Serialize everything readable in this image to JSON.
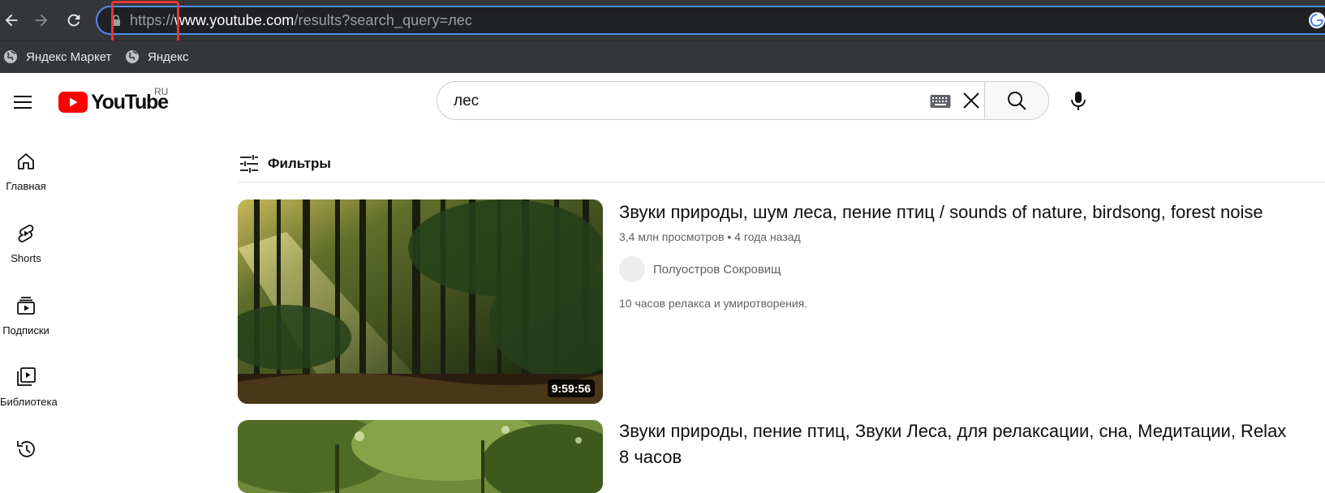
{
  "browser": {
    "url_scheme": "https://",
    "url_host": "www.youtube.com",
    "url_path": "/results?search_query=лес",
    "bookmarks": [
      {
        "label": "Яндекс Маркет"
      },
      {
        "label": "Яндекс"
      }
    ]
  },
  "header": {
    "logo_text": "YouTube",
    "region": "RU",
    "search_value": "лес"
  },
  "sidebar": {
    "items": [
      {
        "label": "Главная",
        "icon": "home-icon"
      },
      {
        "label": "Shorts",
        "icon": "shorts-icon"
      },
      {
        "label": "Подписки",
        "icon": "subscriptions-icon"
      },
      {
        "label": "Библиотека",
        "icon": "library-icon"
      },
      {
        "label": "",
        "icon": "history-icon"
      }
    ]
  },
  "filters": {
    "label": "Фильтры"
  },
  "results": [
    {
      "title": "Звуки природы, шум леса, пение птиц / sounds of nature, birdsong, forest noise",
      "views": "3,4 млн просмотров",
      "age": "4 года назад",
      "channel": "Полуостров Сокровищ",
      "description": "10 часов релакса и умиротворения.",
      "duration": "9:59:56"
    },
    {
      "title": "Звуки природы, пение птиц, Звуки Леса, для релаксации, сна, Медитации, Relax 8 часов"
    }
  ],
  "colors": {
    "chrome_bg": "#35363a",
    "omnibox_bg": "#202124",
    "omnibox_border": "#4d8ff0",
    "highlight": "#e53935",
    "yt_red": "#ff0000"
  }
}
